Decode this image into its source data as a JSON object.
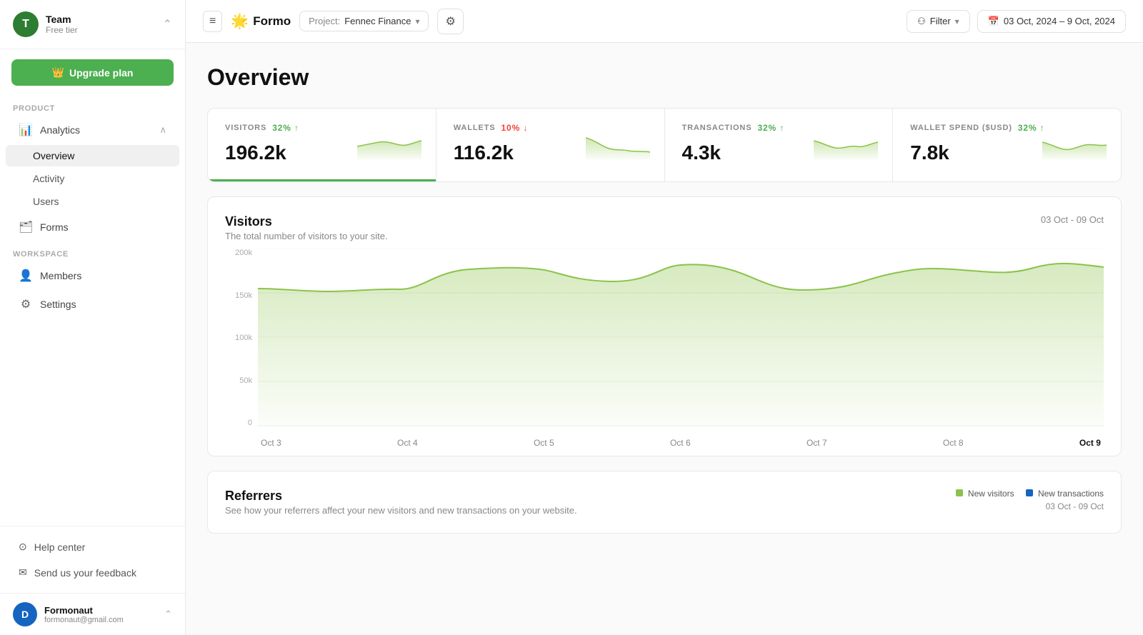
{
  "sidebar": {
    "team": {
      "avatar_letter": "T",
      "name": "Team",
      "tier": "Free tier"
    },
    "upgrade_label": "Upgrade plan",
    "product_section": "Product",
    "analytics_label": "Analytics",
    "nav_items": [
      {
        "id": "overview",
        "label": "Overview",
        "active": true
      },
      {
        "id": "activity",
        "label": "Activity",
        "active": false
      },
      {
        "id": "users",
        "label": "Users",
        "active": false
      }
    ],
    "forms_label": "Forms",
    "workspace_section": "Workspace",
    "workspace_items": [
      {
        "id": "members",
        "label": "Members"
      },
      {
        "id": "settings",
        "label": "Settings"
      }
    ],
    "bottom": {
      "help_center": "Help center",
      "feedback": "Send us your feedback"
    },
    "user": {
      "avatar_letter": "D",
      "name": "Formonaut",
      "email": "formonaut@gmail.com"
    }
  },
  "topbar": {
    "brand": "Formo",
    "brand_emoji": "🌟",
    "project_label": "Project:",
    "project_name": "Fennec Finance",
    "filter_label": "Filter",
    "date_range": "03 Oct, 2024 – 9 Oct, 2024"
  },
  "page": {
    "title": "Overview"
  },
  "stats": [
    {
      "id": "visitors",
      "label": "VISITORS",
      "badge": "32%",
      "trend": "up",
      "value": "196.2k",
      "active": true
    },
    {
      "id": "wallets",
      "label": "WALLETS",
      "badge": "10%",
      "trend": "down",
      "value": "116.2k",
      "active": false
    },
    {
      "id": "transactions",
      "label": "TRANSACTIONS",
      "badge": "32%",
      "trend": "up",
      "value": "4.3k",
      "active": false
    },
    {
      "id": "wallet_spend",
      "label": "WALLET SPEND ($USD)",
      "badge": "32%",
      "trend": "up",
      "value": "7.8k",
      "active": false
    }
  ],
  "visitors_chart": {
    "title": "Visitors",
    "subtitle": "The total number of visitors to your site.",
    "date_label": "03 Oct - 09 Oct",
    "y_labels": [
      "200k",
      "150k",
      "100k",
      "50k",
      "0"
    ],
    "x_labels": [
      "Oct 3",
      "Oct 4",
      "Oct 5",
      "Oct 6",
      "Oct 7",
      "Oct 8",
      "Oct 9"
    ],
    "data_points": [
      155,
      150,
      172,
      178,
      170,
      178,
      148,
      152,
      170,
      175
    ]
  },
  "referrers_chart": {
    "title": "Referrers",
    "subtitle": "See how your referrers affect your new visitors and new transactions on your website.",
    "date_label": "03 Oct - 09 Oct",
    "legend": [
      {
        "label": "New visitors",
        "color": "#8bc34a"
      },
      {
        "label": "New transactions",
        "color": "#1565c0"
      }
    ]
  }
}
